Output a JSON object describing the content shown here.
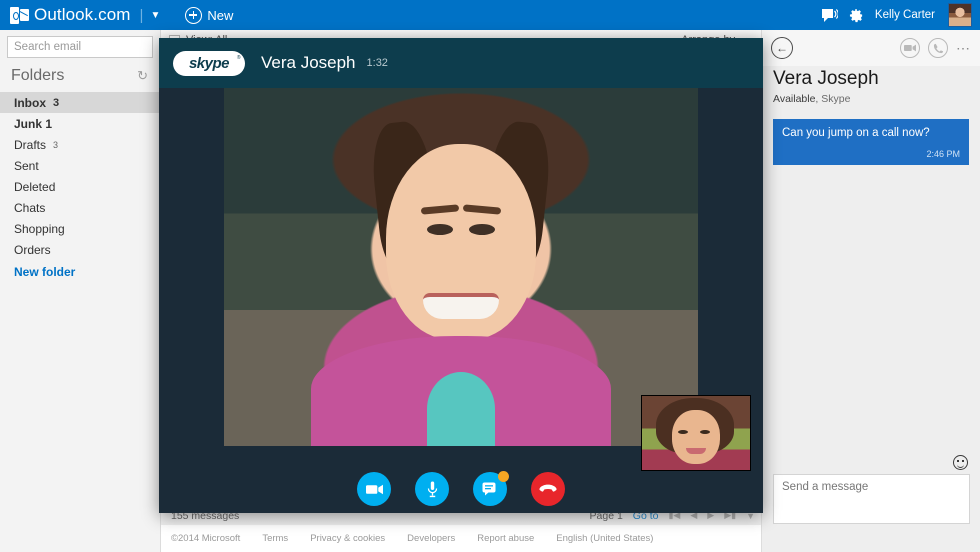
{
  "topbar": {
    "brand": "Outlook.com",
    "brand_caret_icon": "chevron-down-icon",
    "new_label": "New",
    "new_icon": "plus-circle-icon",
    "messaging_icon": "messaging-icon",
    "settings_icon": "gear-icon",
    "user_name": "Kelly Carter",
    "avatar_icon": "user-avatar",
    "bg_color": "#0072c6"
  },
  "sidebar": {
    "search_placeholder": "Search email",
    "search_value": "",
    "search_icon": "search-icon",
    "folders_title": "Folders",
    "refresh_icon": "refresh-icon",
    "items": [
      {
        "label": "Inbox",
        "count": "3"
      },
      {
        "label": "Junk 1",
        "count": ""
      },
      {
        "label": "Drafts",
        "count": "3"
      },
      {
        "label": "Sent",
        "count": ""
      },
      {
        "label": "Deleted",
        "count": ""
      },
      {
        "label": "Chats",
        "count": ""
      },
      {
        "label": "Shopping",
        "count": ""
      },
      {
        "label": "Orders",
        "count": ""
      }
    ],
    "new_folder_label": "New folder",
    "link_color": "#0072c6"
  },
  "maillist": {
    "toolbar_view_label": "View: All",
    "toolbar_arrange_label": "Arrange by",
    "toolbar_collapse_icon": "chevron-up-icon",
    "status_count": "155 messages",
    "page_label": "Page 1",
    "goto_label": "Go to",
    "nav_first_icon": "first-page-icon",
    "nav_prev_icon": "previous-page-icon",
    "nav_next_icon": "next-page-icon",
    "nav_last_icon": "last-page-icon",
    "nav_more_icon": "chevron-down-icon",
    "footer": {
      "copyright": "©2014 Microsoft",
      "terms": "Terms",
      "privacy": "Privacy & cookies",
      "developers": "Developers",
      "report": "Report abuse",
      "language": "English (United States)"
    }
  },
  "chatpanel": {
    "back_icon": "back-arrow-icon",
    "video_icon": "video-camera-icon",
    "call_icon": "phone-icon",
    "more_icon": "ellipsis-icon",
    "contact_name": "Vera Joseph",
    "status_availability": "Available",
    "status_service": ", Skype",
    "messages": [
      {
        "text": "Can you jump on a call now?",
        "time": "2:46 PM"
      }
    ],
    "bubble_color": "#1f6fc4",
    "emoji_icon": "smiley-icon",
    "compose_placeholder": "Send a message"
  },
  "skype": {
    "logo_text": "skype",
    "contact_name": "Vera Joseph",
    "call_duration": "1:32",
    "header_color": "#0d3d4d",
    "body_color": "#1b2b38",
    "controls": [
      {
        "name": "video-toggle",
        "icon": "video-camera-icon",
        "color": "#00aff0",
        "badge": false
      },
      {
        "name": "microphone-toggle",
        "icon": "microphone-icon",
        "color": "#00aff0",
        "badge": false
      },
      {
        "name": "chat-toggle",
        "icon": "chat-bubble-icon",
        "color": "#00aff0",
        "badge": true
      },
      {
        "name": "end-call",
        "icon": "end-call-icon",
        "color": "#e8262b",
        "badge": false
      }
    ],
    "self_view_name": "self-view-thumbnail",
    "remote_view_name": "remote-video-feed"
  }
}
